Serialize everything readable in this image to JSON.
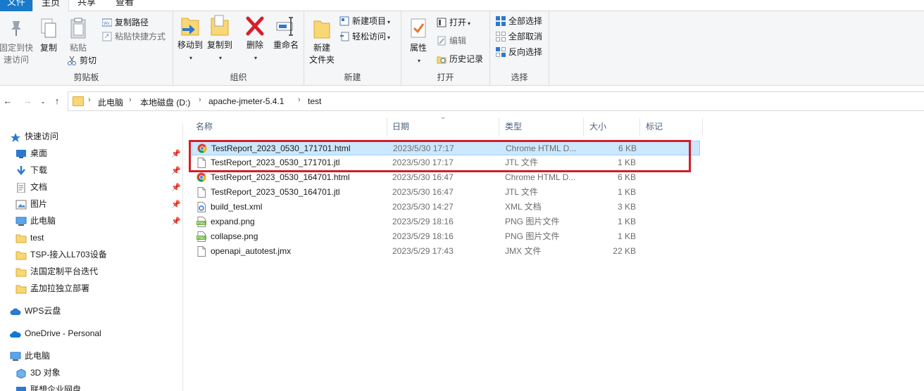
{
  "ribbon_tabs": {
    "file": "文件",
    "home": "主页",
    "share": "共享",
    "view": "查看"
  },
  "ribbon": {
    "clipboard": {
      "label": "剪贴板",
      "pin_line1": "固定到快",
      "pin_line2": "速访问",
      "copy": "复制",
      "paste": "粘贴",
      "copy_path": "复制路径",
      "paste_shortcut": "粘贴快捷方式",
      "cut": "剪切"
    },
    "organize": {
      "label": "组织",
      "move_to": "移动到",
      "copy_to": "复制到",
      "delete": "删除",
      "rename": "重命名"
    },
    "new": {
      "label": "新建",
      "new_folder_line1": "新建",
      "new_folder_line2": "文件夹",
      "new_item": "新建项目",
      "easy_access": "轻松访问"
    },
    "open": {
      "label": "打开",
      "properties": "属性",
      "open": "打开",
      "edit": "编辑",
      "history": "历史记录"
    },
    "select": {
      "label": "选择",
      "select_all": "全部选择",
      "select_none": "全部取消",
      "invert": "反向选择"
    }
  },
  "address": {
    "crumbs": [
      "此电脑",
      "本地磁盘 (D:)",
      "apache-jmeter-5.4.1",
      "test"
    ]
  },
  "nav": {
    "quick_access": "快速访问",
    "desktop": "桌面",
    "downloads": "下载",
    "documents": "文档",
    "pictures": "图片",
    "this_pc_pinned": "此电脑",
    "folder_test": "test",
    "folder_tsp": "TSP-接入LL703设备",
    "folder_france": "法国定制平台迭代",
    "folder_bangladesh": "孟加拉独立部署",
    "wps": "WPS云盘",
    "onedrive": "OneDrive - Personal",
    "this_pc": "此电脑",
    "objects3d": "3D 对象",
    "lenovo_disk": "联想企业网盘"
  },
  "columns": {
    "name": "名称",
    "date": "日期",
    "type": "类型",
    "size": "大小",
    "tags": "标记"
  },
  "files": [
    {
      "name": "TestReport_2023_0530_171701.html",
      "date": "2023/5/30 17:17",
      "type": "Chrome HTML D...",
      "size": "6 KB",
      "icon": "chrome-icon"
    },
    {
      "name": "TestReport_2023_0530_171701.jtl",
      "date": "2023/5/30 17:17",
      "type": "JTL 文件",
      "size": "1 KB",
      "icon": "file-icon"
    },
    {
      "name": "TestReport_2023_0530_164701.html",
      "date": "2023/5/30 16:47",
      "type": "Chrome HTML D...",
      "size": "6 KB",
      "icon": "chrome-icon"
    },
    {
      "name": "TestReport_2023_0530_164701.jtl",
      "date": "2023/5/30 16:47",
      "type": "JTL 文件",
      "size": "1 KB",
      "icon": "file-icon"
    },
    {
      "name": "build_test.xml",
      "date": "2023/5/30 14:27",
      "type": "XML 文档",
      "size": "3 KB",
      "icon": "xml-icon"
    },
    {
      "name": "expand.png",
      "date": "2023/5/29 18:16",
      "type": "PNG 图片文件",
      "size": "1 KB",
      "icon": "png-icon"
    },
    {
      "name": "collapse.png",
      "date": "2023/5/29 18:16",
      "type": "PNG 图片文件",
      "size": "1 KB",
      "icon": "png-icon"
    },
    {
      "name": "openapi_autotest.jmx",
      "date": "2023/5/29 17:43",
      "type": "JMX 文件",
      "size": "22 KB",
      "icon": "file-icon"
    }
  ],
  "colors": {
    "accent": "#1979ca",
    "selection": "#cce8ff",
    "highlight_box": "#d21e2b",
    "folder": "#f8d775"
  }
}
